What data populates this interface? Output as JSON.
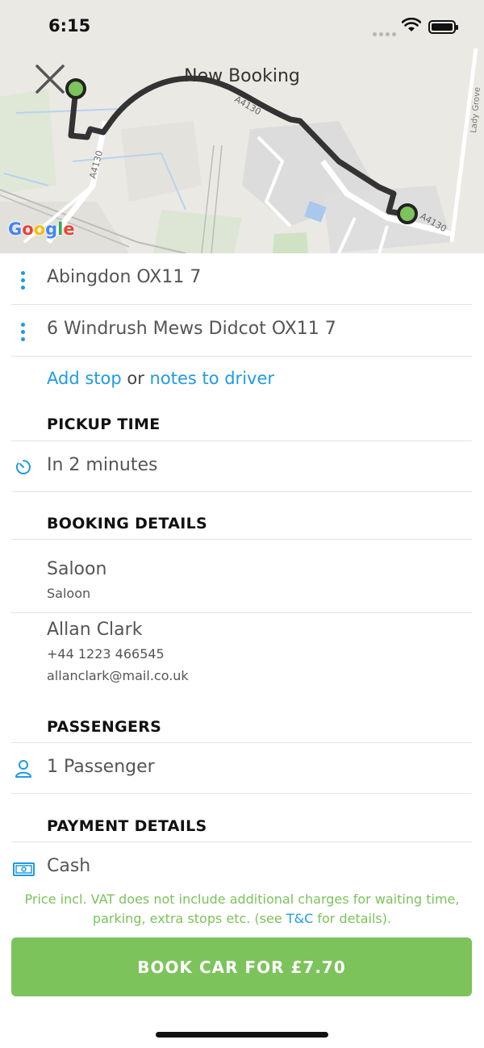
{
  "status_bar": {
    "time": "6:15"
  },
  "map": {
    "title": "New Booking",
    "google_logo": [
      "G",
      "o",
      "o",
      "g",
      "l",
      "e"
    ],
    "google_colors": [
      "#4285F4",
      "#EA4335",
      "#FBBC05",
      "#4285F4",
      "#34A853",
      "#EA4335"
    ],
    "road_labels": {
      "a4130_left": "A4130",
      "a4130_top": "A4130",
      "a4130_right": "A4130",
      "lady_grove": "Lady Grove"
    },
    "route_color": "#333333",
    "marker_color": "#7cc35b"
  },
  "pickup": {
    "address": "Abingdon OX11 7"
  },
  "dropoff": {
    "address": "6 Windrush Mews Didcot OX11 7"
  },
  "extras": {
    "add_stop": "Add stop",
    "or": "or",
    "notes": "notes to driver"
  },
  "pickup_time": {
    "title": "PICKUP TIME",
    "value": "In 2 minutes"
  },
  "booking_details": {
    "title": "BOOKING DETAILS",
    "vehicle_name": "Saloon",
    "vehicle_type": "Saloon",
    "passenger_name": "Allan Clark",
    "phone": "+44 1223 466545",
    "email": "allanclark@mail.co.uk"
  },
  "passengers": {
    "title": "PASSENGERS",
    "value": "1 Passenger"
  },
  "payment": {
    "title": "PAYMENT DETAILS",
    "value": "Cash"
  },
  "disclaimer": {
    "line1": "Price incl. VAT does not include additional charges for waiting time,",
    "line2_before": "parking, extra stops etc. (see",
    "tc": "T&C",
    "line2_after": "for details)."
  },
  "book_button": {
    "label": "BOOK CAR FOR £7.70"
  },
  "colors": {
    "accent_blue": "#1e9be4",
    "accent_green": "#7cc35b"
  }
}
